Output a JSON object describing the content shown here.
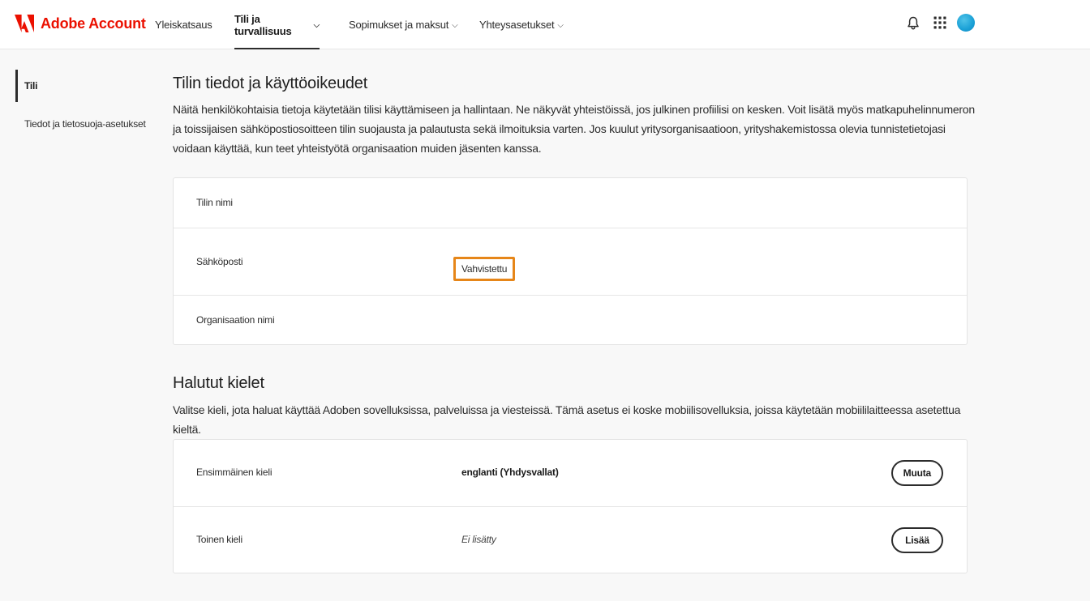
{
  "header": {
    "brand": "Adobe Account",
    "nav": [
      {
        "label": "Yleiskatsaus",
        "has_menu": false
      },
      {
        "label": "Tili ja turvallisuus",
        "has_menu": true,
        "active": true
      },
      {
        "label": "Sopimukset ja maksut",
        "has_menu": true
      },
      {
        "label": "Yhteysasetukset",
        "has_menu": true
      }
    ],
    "chevron": "⌵",
    "icons": [
      "bell-icon",
      "apps-grid-icon",
      "avatar"
    ],
    "brand_color": "#eb1000"
  },
  "sidebar": {
    "items": [
      {
        "label": "Tili",
        "active": true
      },
      {
        "label": "Tiedot ja tietosuoja-asetukset",
        "active": false
      }
    ]
  },
  "account_section": {
    "title": "Tilin tiedot ja käyttöoikeudet",
    "description": "Näitä henkilökohtaisia tietoja käytetään tilisi käyttämiseen ja hallintaan. Ne näkyvät yhteistöissä, jos julkinen profiilisi on kesken. Voit lisätä myös matkapuhelinnumeron ja toissijaisen sähköpostiosoitteen tilin suojausta ja palautusta sekä ilmoituksia varten. Jos kuulut yritysorganisaatioon, yrityshakemistossa olevia tunnistetietojasi voidaan käyttää, kun teet yhteistyötä organisaation muiden jäsenten kanssa.",
    "rows": {
      "account_name_label": "Tilin nimi",
      "email_label": "Sähköposti",
      "email_status": "Vahvistettu",
      "org_name_label": "Organisaation nimi"
    },
    "highlight_color": "#e68619"
  },
  "languages_section": {
    "title": "Halutut kielet",
    "description": "Valitse kieli, jota haluat käyttää Adoben sovelluksissa, palveluissa ja viesteissä. Tämä asetus ei koske mobiilisovelluksia, joissa käytetään mobiililaitteessa asetettua kieltä.",
    "rows": {
      "primary_label": "Ensimmäinen kieli",
      "primary_value": "englanti (Yhdysvallat)",
      "primary_button": "Muuta",
      "secondary_label": "Toinen kieli",
      "secondary_value": "Ei lisätty",
      "secondary_button": "Lisää"
    }
  }
}
